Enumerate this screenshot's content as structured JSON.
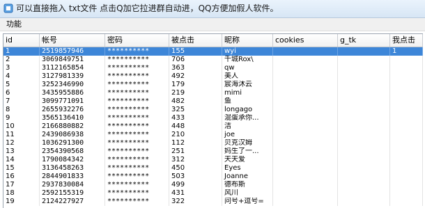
{
  "window": {
    "title": "可以直接拖入 txt文件 点击Q加它拉进群自动进，QQ方便加假人软件。"
  },
  "menu": {
    "items": [
      "功能"
    ]
  },
  "table": {
    "headers": [
      "id",
      "帐号",
      "密码",
      "被点击",
      "昵称",
      "cookies",
      "g_tk",
      "我点击"
    ],
    "selected_row": 0,
    "rows": [
      [
        "1",
        "2519857946",
        "**********",
        "155",
        "wyi",
        "",
        "",
        "1"
      ],
      [
        "2",
        "3069849751",
        "**********",
        "706",
        "千城Rox\\",
        "",
        "",
        ""
      ],
      [
        "3",
        "3112165854",
        "**********",
        "363",
        "qw",
        "",
        "",
        ""
      ],
      [
        "4",
        "3127981339",
        "**********",
        "492",
        "美人",
        "",
        "",
        ""
      ],
      [
        "5",
        "3252346990",
        "**********",
        "179",
        "宸海沐云",
        "",
        "",
        ""
      ],
      [
        "6",
        "3435955886",
        "**********",
        "219",
        "mimi",
        "",
        "",
        ""
      ],
      [
        "7",
        "3099771091",
        "**********",
        "482",
        "鱼",
        "",
        "",
        ""
      ],
      [
        "8",
        "2655932276",
        "**********",
        "325",
        "longago",
        "",
        "",
        ""
      ],
      [
        "9",
        "3565136410",
        "**********",
        "433",
        "混蛋承你...",
        "",
        "",
        ""
      ],
      [
        "10",
        "2166880882",
        "**********",
        "448",
        "洁",
        "",
        "",
        ""
      ],
      [
        "11",
        "2439086938",
        "**********",
        "210",
        "joe",
        "",
        "",
        ""
      ],
      [
        "12",
        "1036291300",
        "**********",
        "112",
        "贝克汉姆",
        "",
        "",
        ""
      ],
      [
        "13",
        "2354390568",
        "**********",
        "251",
        "妈生了一...",
        "",
        "",
        ""
      ],
      [
        "14",
        "1790084342",
        "**********",
        "312",
        "天天爱",
        "",
        "",
        ""
      ],
      [
        "15",
        "3136458263",
        "**********",
        "450",
        "Eyes",
        "",
        "",
        ""
      ],
      [
        "16",
        "2844901833",
        "**********",
        "503",
        "Joanne",
        "",
        "",
        ""
      ],
      [
        "17",
        "2937830084",
        "**********",
        "499",
        "德布斯",
        "",
        "",
        ""
      ],
      [
        "18",
        "2592155319",
        "**********",
        "431",
        "风川",
        "",
        "",
        ""
      ],
      [
        "19",
        "2124227927",
        "**********",
        "322",
        "问号+逗号=",
        "",
        "",
        ""
      ]
    ]
  }
}
